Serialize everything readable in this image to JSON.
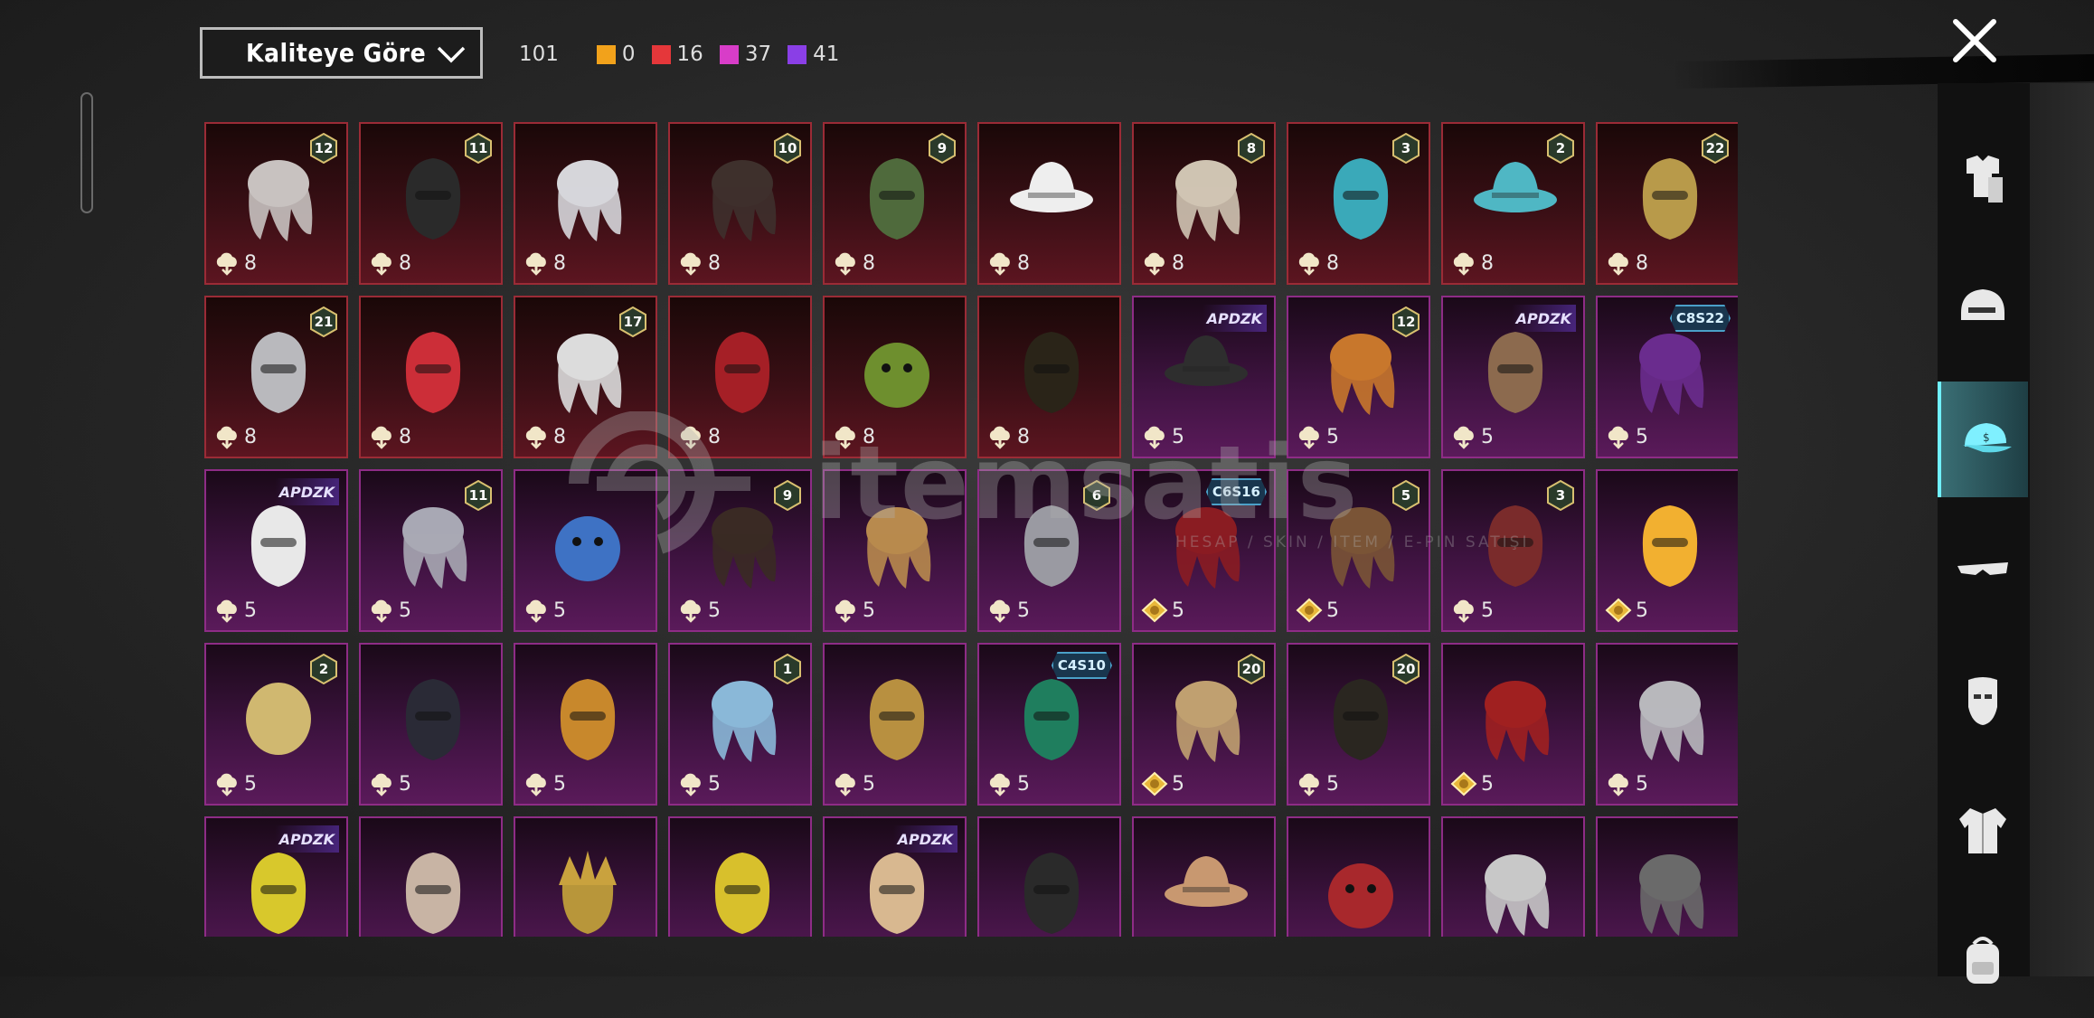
{
  "sort": {
    "label": "Kaliteye Göre"
  },
  "counts": {
    "total": "101",
    "rarity": [
      {
        "value": "0",
        "color": "#f2a21b"
      },
      {
        "value": "16",
        "color": "#e5373a"
      },
      {
        "value": "37",
        "color": "#d83dc8"
      },
      {
        "value": "41",
        "color": "#8a3fe6"
      }
    ]
  },
  "watermark": {
    "text": "itemsatis",
    "sub": "HESAP / SKIN / ITEM / E-PIN SATIŞI"
  },
  "items": [
    {
      "q": "8",
      "tier": "red",
      "badge": "12",
      "cur": "cloud",
      "art": "hair-white",
      "c": "#c8c2c0"
    },
    {
      "q": "8",
      "tier": "red",
      "badge": "11",
      "cur": "cloud",
      "art": "helmet-black",
      "c": "#2a2a2a"
    },
    {
      "q": "8",
      "tier": "red",
      "badge": "",
      "cur": "cloud",
      "art": "hair-white",
      "c": "#d6d6da"
    },
    {
      "q": "8",
      "tier": "red",
      "badge": "10",
      "cur": "cloud",
      "art": "hair-dark",
      "c": "#3e302c"
    },
    {
      "q": "8",
      "tier": "red",
      "badge": "9",
      "cur": "cloud",
      "art": "zombie-head",
      "c": "#4f6a3c"
    },
    {
      "q": "8",
      "tier": "red",
      "badge": "",
      "cur": "cloud",
      "art": "cowboy-hat",
      "c": "#eeeeee"
    },
    {
      "q": "8",
      "tier": "red",
      "badge": "8",
      "cur": "cloud",
      "art": "hair-blonde",
      "c": "#cfc4b2"
    },
    {
      "q": "8",
      "tier": "red",
      "badge": "3",
      "cur": "cloud",
      "art": "joker-head",
      "c": "#3aa9b9"
    },
    {
      "q": "8",
      "tier": "red",
      "badge": "2",
      "cur": "cloud",
      "art": "bucket-hat",
      "c": "#4fb7c4"
    },
    {
      "q": "8",
      "tier": "red",
      "badge": "22",
      "cur": "cloud",
      "art": "pharaoh-mask",
      "c": "#b89a4a"
    },
    {
      "q": "8",
      "tier": "red",
      "badge": "21",
      "cur": "cloud",
      "art": "demon-mask",
      "c": "#b9b9bd"
    },
    {
      "q": "8",
      "tier": "red",
      "badge": "",
      "cur": "cloud",
      "art": "oni-mask",
      "c": "#cc2e38"
    },
    {
      "q": "8",
      "tier": "red",
      "badge": "17",
      "cur": "cloud",
      "art": "hair-white",
      "c": "#dcdcdc"
    },
    {
      "q": "8",
      "tier": "red",
      "badge": "",
      "cur": "cloud",
      "art": "red-helmet",
      "c": "#a51f26"
    },
    {
      "q": "8",
      "tier": "red",
      "badge": "",
      "cur": "cloud",
      "art": "lion-dance",
      "c": "#6e8f2e"
    },
    {
      "q": "8",
      "tier": "red",
      "badge": "",
      "cur": "cloud",
      "art": "gold-black-helmet",
      "c": "#2a2418"
    },
    {
      "q": "5",
      "tier": "purple",
      "badge": "",
      "tag": "APDZK",
      "cur": "cloud",
      "art": "cap-black",
      "c": "#2e2e2e"
    },
    {
      "q": "5",
      "tier": "purple",
      "badge": "12",
      "cur": "cloud",
      "art": "hair-orange",
      "c": "#c8772c"
    },
    {
      "q": "5",
      "tier": "purple",
      "badge": "",
      "tag": "APDZK",
      "cur": "cloud",
      "art": "alpaca-head",
      "c": "#8c6a4e"
    },
    {
      "q": "5",
      "tier": "purple",
      "badge": "",
      "tag": "C8S22",
      "cur": "cloud",
      "art": "hair-purple",
      "c": "#6a2c8e"
    },
    {
      "q": "5",
      "tier": "purple",
      "badge": "",
      "tag": "APDZK",
      "cur": "cloud",
      "art": "panda-head",
      "c": "#e8e8e8"
    },
    {
      "q": "5",
      "tier": "purple",
      "badge": "11",
      "cur": "cloud",
      "art": "veil-flowers",
      "c": "#a8a8b4"
    },
    {
      "q": "5",
      "tier": "purple",
      "badge": "",
      "cur": "cloud",
      "art": "blue-bird",
      "c": "#3e72c4"
    },
    {
      "q": "5",
      "tier": "purple",
      "badge": "9",
      "cur": "cloud",
      "art": "hair-dark",
      "c": "#3a2a24"
    },
    {
      "q": "5",
      "tier": "purple",
      "badge": "",
      "cur": "cloud",
      "art": "hair-blonde",
      "c": "#b88a4e"
    },
    {
      "q": "5",
      "tier": "purple",
      "badge": "6",
      "cur": "cloud",
      "art": "eagle-mask",
      "c": "#9a9aa2"
    },
    {
      "q": "5",
      "tier": "purple",
      "badge": "",
      "tag": "C6S16",
      "cur": "coin",
      "art": "hair-red",
      "c": "#8a1c22"
    },
    {
      "q": "5",
      "tier": "purple",
      "badge": "5",
      "cur": "coin",
      "art": "hair-brown",
      "c": "#7a5436"
    },
    {
      "q": "5",
      "tier": "purple",
      "badge": "3",
      "cur": "cloud",
      "art": "jester-mask",
      "c": "#7a2b2b"
    },
    {
      "q": "5",
      "tier": "purple",
      "badge": "",
      "cur": "coin",
      "art": "duck-head",
      "c": "#f2b030"
    },
    {
      "q": "5",
      "tier": "purple",
      "badge": "2",
      "cur": "cloud",
      "art": "hood-ribbon",
      "c": "#d0b870"
    },
    {
      "q": "5",
      "tier": "purple",
      "badge": "",
      "cur": "cloud",
      "art": "cyber-helmet",
      "c": "#2a2a36"
    },
    {
      "q": "5",
      "tier": "purple",
      "badge": "",
      "cur": "cloud",
      "art": "potato-head",
      "c": "#c8882c"
    },
    {
      "q": "5",
      "tier": "purple",
      "badge": "1",
      "cur": "cloud",
      "art": "pigtails",
      "c": "#8ab8d8"
    },
    {
      "q": "5",
      "tier": "purple",
      "badge": "",
      "cur": "cloud",
      "art": "anubis-helmet",
      "c": "#b89040"
    },
    {
      "q": "5",
      "tier": "purple",
      "badge": "",
      "tag": "C4S10",
      "cur": "cloud",
      "art": "green-helmet",
      "c": "#1f7e5e"
    },
    {
      "q": "5",
      "tier": "purple",
      "badge": "20",
      "cur": "coin",
      "art": "bunny-hair",
      "c": "#c0a070"
    },
    {
      "q": "5",
      "tier": "purple",
      "badge": "20",
      "cur": "cloud",
      "art": "black-gold-helmet",
      "c": "#2a2620"
    },
    {
      "q": "5",
      "tier": "purple",
      "badge": "",
      "cur": "coin",
      "art": "twin-red-hair",
      "c": "#a02020"
    },
    {
      "q": "5",
      "tier": "purple",
      "badge": "",
      "cur": "cloud",
      "art": "crown-hair",
      "c": "#b8b8bc"
    },
    {
      "q": "",
      "tier": "purple",
      "badge": "",
      "tag": "APDZK",
      "cur": "",
      "art": "yellow-helmet",
      "c": "#d8c82c"
    },
    {
      "q": "",
      "tier": "purple",
      "badge": "",
      "cur": "",
      "art": "bird-head",
      "c": "#c8b4a4"
    },
    {
      "q": "",
      "tier": "purple",
      "badge": "",
      "cur": "",
      "art": "crown-gold",
      "c": "#b8963a"
    },
    {
      "q": "",
      "tier": "purple",
      "badge": "",
      "cur": "",
      "art": "duck-mask",
      "c": "#d8c02c"
    },
    {
      "q": "",
      "tier": "purple",
      "badge": "",
      "tag": "APDZK",
      "cur": "",
      "art": "cat-head",
      "c": "#d8b890"
    },
    {
      "q": "",
      "tier": "purple",
      "badge": "",
      "cur": "",
      "art": "cat-mask-black",
      "c": "#2a2a2a"
    },
    {
      "q": "",
      "tier": "purple",
      "badge": "",
      "cur": "",
      "art": "cupcake-hat",
      "c": "#c89870"
    },
    {
      "q": "",
      "tier": "purple",
      "badge": "",
      "cur": "",
      "art": "red-bow",
      "c": "#a8282c"
    },
    {
      "q": "",
      "tier": "purple",
      "badge": "",
      "cur": "",
      "art": "dreadlocks-mask",
      "c": "#c8c8c8"
    },
    {
      "q": "",
      "tier": "purple",
      "badge": "",
      "cur": "",
      "art": "skull-dreads",
      "c": "#6a6a6a"
    }
  ],
  "sidebar": [
    {
      "name": "outfit-icon"
    },
    {
      "name": "helmet-icon"
    },
    {
      "name": "cap-icon",
      "active": true
    },
    {
      "name": "glasses-icon"
    },
    {
      "name": "mask-icon"
    },
    {
      "name": "jacket-icon"
    },
    {
      "name": "backpack-icon"
    }
  ]
}
